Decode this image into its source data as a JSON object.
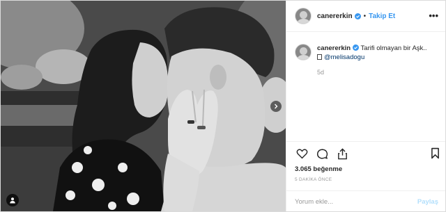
{
  "header": {
    "username": "canererkin",
    "separator": "•",
    "follow_label": "Takip Et",
    "more_label": "•••"
  },
  "caption": {
    "username": "canererkin",
    "text": "Tarifi olmayan bir Aşk..",
    "mention": "@melisadogu",
    "time": "5d"
  },
  "engagement": {
    "likes": "3.065 beğenme",
    "posted": "5 DAKİKA ÖNCE"
  },
  "comment_box": {
    "placeholder": "Yorum ekle...",
    "post_label": "Paylaş"
  },
  "icons": [
    "verified-badge-icon",
    "heart-icon",
    "comment-icon",
    "share-icon",
    "bookmark-icon",
    "chevron-right-icon",
    "user-tag-icon"
  ],
  "colors": {
    "link": "#3897f0",
    "verified": "#3897f0",
    "text": "#262626",
    "muted": "#999999"
  }
}
